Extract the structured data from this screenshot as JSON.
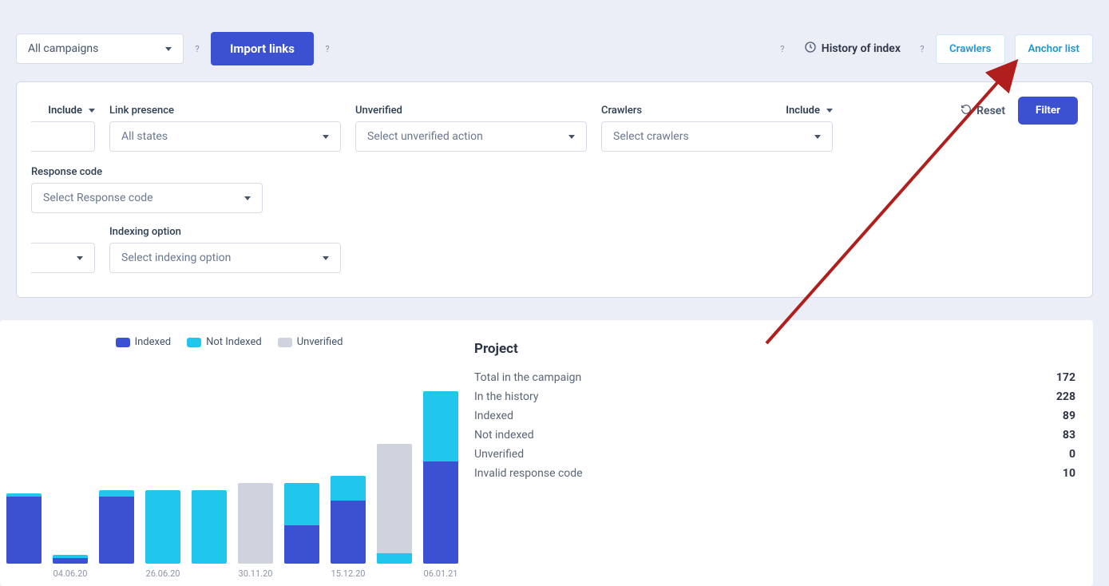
{
  "toolbar": {
    "campaign_selector": "All campaigns",
    "import_label": "Import links",
    "history_label": "History of index",
    "crawlers_label": "Crawlers",
    "anchor_label": "Anchor list"
  },
  "filters": {
    "reset_label": "Reset",
    "filter_label": "Filter",
    "include_label": "Include",
    "link_presence": {
      "label": "Link presence",
      "value": "All states"
    },
    "unverified": {
      "label": "Unverified",
      "value": "Select unverified action"
    },
    "crawlers": {
      "label": "Crawlers",
      "value": "Select crawlers"
    },
    "response_code": {
      "label": "Response code",
      "value": "Select Response code"
    },
    "indexing_option": {
      "label": "Indexing option",
      "value": "Select indexing option"
    }
  },
  "legend": {
    "indexed": "Indexed",
    "not_indexed": "Not Indexed",
    "unverified": "Unverified"
  },
  "colors": {
    "indexed": "#3b51d1",
    "not_indexed": "#20c6ec",
    "unverified": "#cfd3dd"
  },
  "chart_data": {
    "type": "bar",
    "title": "",
    "xlabel": "",
    "ylabel": "",
    "ylim": [
      0,
      100
    ],
    "categories": [
      "",
      "04.06.20",
      "",
      "26.06.20",
      "",
      "30.11.20",
      "",
      "15.12.20",
      "",
      "06.01.21"
    ],
    "series": [
      {
        "name": "Indexed",
        "values": [
          38,
          3,
          38,
          0,
          0,
          0,
          22,
          36,
          0,
          58
        ]
      },
      {
        "name": "Not Indexed",
        "values": [
          2,
          2,
          4,
          42,
          42,
          0,
          24,
          14,
          6,
          40
        ]
      },
      {
        "name": "Unverified",
        "values": [
          0,
          0,
          0,
          0,
          0,
          46,
          0,
          0,
          62,
          0
        ]
      }
    ]
  },
  "stats": {
    "title": "Project",
    "rows": [
      {
        "label": "Total in the campaign",
        "value": "172"
      },
      {
        "label": "In the history",
        "value": "228"
      },
      {
        "label": "Indexed",
        "value": "89"
      },
      {
        "label": "Not indexed",
        "value": "83"
      },
      {
        "label": "Unverified",
        "value": "0"
      },
      {
        "label": "Invalid response code",
        "value": "10"
      }
    ]
  }
}
